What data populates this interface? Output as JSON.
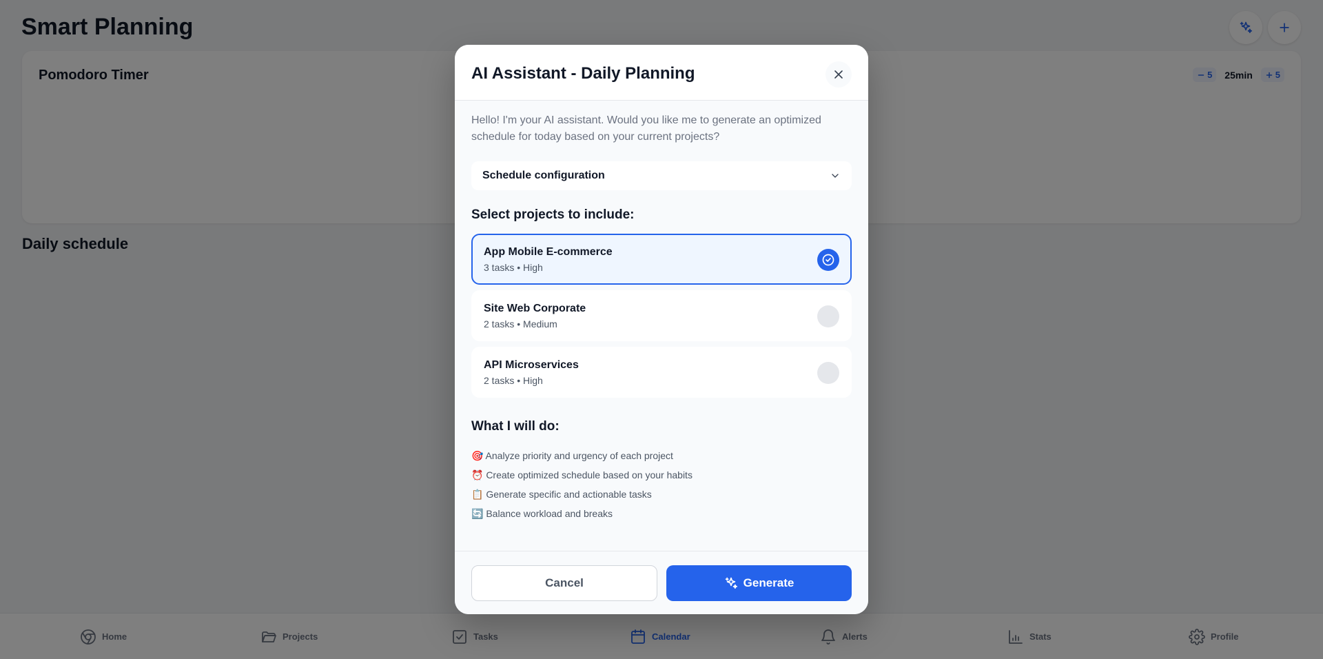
{
  "app": {
    "title": "Smart Planning",
    "top_actions": [
      {
        "icon": "sparkles-icon"
      },
      {
        "icon": "plus-icon"
      }
    ]
  },
  "pomodoro": {
    "title": "Pomodoro Timer",
    "decrement_label": "5",
    "duration_label": "25min",
    "increment_label": "5"
  },
  "schedule": {
    "title": "Daily schedule"
  },
  "bottom_nav": {
    "active": "Calendar",
    "items": [
      {
        "label": "Home",
        "icon": "home-icon"
      },
      {
        "label": "Projects",
        "icon": "folder-icon"
      },
      {
        "label": "Tasks",
        "icon": "checkbox-icon"
      },
      {
        "label": "Calendar",
        "icon": "calendar-icon"
      },
      {
        "label": "Alerts",
        "icon": "bell-icon"
      },
      {
        "label": "Stats",
        "icon": "bar-chart-icon"
      },
      {
        "label": "Profile",
        "icon": "gear-icon"
      }
    ]
  },
  "modal": {
    "title": "AI Assistant - Daily Planning",
    "intro": "Hello! I'm your AI assistant. Would you like me to generate an optimized schedule for today based on your current projects?",
    "config_label": "Schedule configuration",
    "projects_heading": "Select projects to include:",
    "projects": [
      {
        "name": "App Mobile E-commerce",
        "meta": "3 tasks • High",
        "selected": true
      },
      {
        "name": "Site Web Corporate",
        "meta": "2 tasks • Medium",
        "selected": false
      },
      {
        "name": "API Microservices",
        "meta": "2 tasks • High",
        "selected": false
      }
    ],
    "actions_heading": "What I will do:",
    "actions": [
      "🎯 Analyze priority and urgency of each project",
      "⏰ Create optimized schedule based on your habits",
      "📋 Generate specific and actionable tasks",
      "🔄 Balance workload and breaks"
    ],
    "cancel_label": "Cancel",
    "generate_label": "Generate"
  },
  "colors": {
    "accent": "#2563eb",
    "overlay": "rgba(0,0,0,0.5)"
  }
}
